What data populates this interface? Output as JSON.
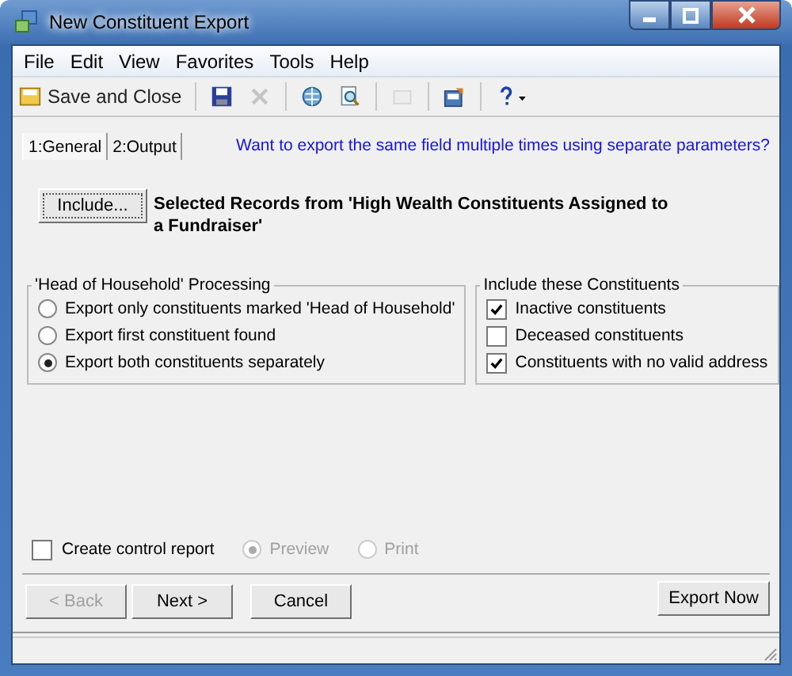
{
  "window": {
    "title": "New Constituent Export"
  },
  "menu": [
    "File",
    "Edit",
    "View",
    "Favorites",
    "Tools",
    "Help"
  ],
  "toolbar": [
    {
      "kind": "saveclose",
      "label": "Save and Close",
      "disabled": false
    },
    {
      "kind": "save",
      "disabled": false
    },
    {
      "kind": "delete",
      "disabled": true
    },
    {
      "kind": "globe",
      "disabled": false
    },
    {
      "kind": "preview",
      "disabled": false
    },
    {
      "kind": "blank",
      "disabled": true
    },
    {
      "kind": "properties",
      "disabled": false
    },
    {
      "kind": "help",
      "disabled": false
    }
  ],
  "tabs": [
    {
      "label": "1:General",
      "selected": true
    },
    {
      "label": "2:Output",
      "selected": false
    }
  ],
  "link": "Want to export the same field multiple times using separate parameters?",
  "include": {
    "button": "Include...",
    "selection": "Selected Records from 'High Wealth Constituents Assigned to a Fundraiser'"
  },
  "household": {
    "title": "'Head of Household' Processing",
    "options": [
      {
        "label": "Export only constituents marked 'Head of Household'",
        "selected": false
      },
      {
        "label": "Export first constituent found",
        "selected": false
      },
      {
        "label": "Export both constituents separately",
        "selected": true
      }
    ]
  },
  "constituents": {
    "title": "Include these Constituents",
    "options": [
      {
        "label": "Inactive constituents",
        "checked": true
      },
      {
        "label": "Deceased constituents",
        "checked": false
      },
      {
        "label": "Constituents with no valid address",
        "checked": true
      }
    ]
  },
  "control_report": {
    "label": "Create control report",
    "checked": false,
    "options": [
      {
        "label": "Preview",
        "selected": true,
        "disabled": true
      },
      {
        "label": "Print",
        "selected": false,
        "disabled": true
      }
    ]
  },
  "buttons": [
    {
      "label": "< Back",
      "disabled": true
    },
    {
      "label": "Next >",
      "disabled": false
    },
    {
      "label": "Cancel",
      "disabled": false
    }
  ],
  "export_button": "Export Now"
}
